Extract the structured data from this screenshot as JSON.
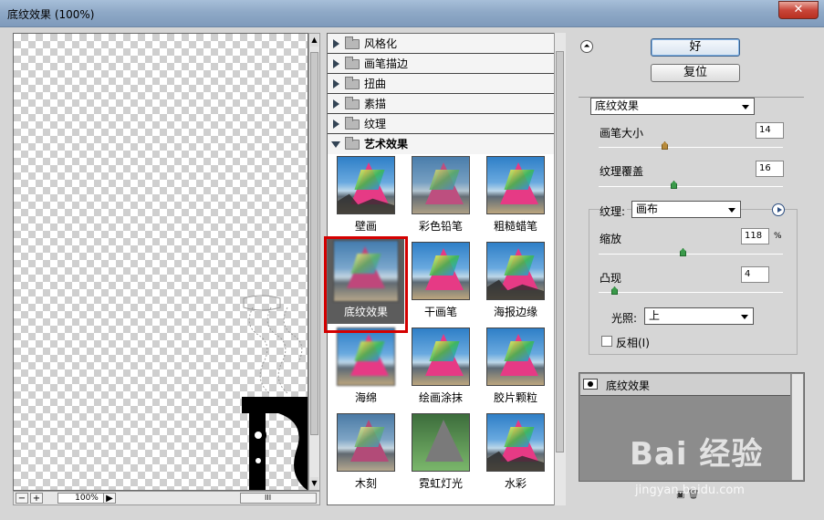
{
  "window": {
    "title": "底纹效果 (100%)",
    "close_label": "✕"
  },
  "preview": {
    "zoom": "100%",
    "minus": "−",
    "plus": "+",
    "scroll_grip": "III"
  },
  "gallery": {
    "categories": [
      {
        "label": "风格化",
        "expanded": false
      },
      {
        "label": "画笔描边",
        "expanded": false
      },
      {
        "label": "扭曲",
        "expanded": false
      },
      {
        "label": "素描",
        "expanded": false
      },
      {
        "label": "纹理",
        "expanded": false
      },
      {
        "label": "艺术效果",
        "expanded": true
      }
    ],
    "filters": [
      {
        "label": "壁画"
      },
      {
        "label": "彩色铅笔"
      },
      {
        "label": "粗糙蜡笔"
      },
      {
        "label": "底纹效果",
        "selected": true
      },
      {
        "label": "干画笔"
      },
      {
        "label": "海报边缘"
      },
      {
        "label": "海绵"
      },
      {
        "label": "绘画涂抹"
      },
      {
        "label": "胶片颗粒"
      },
      {
        "label": "木刻"
      },
      {
        "label": "霓虹灯光"
      },
      {
        "label": "水彩"
      }
    ]
  },
  "buttons": {
    "ok": "好",
    "reset": "复位",
    "collapse_icon": "⏶"
  },
  "settings": {
    "filter_select": "底纹效果",
    "brush_size_label": "画笔大小",
    "brush_size_value": "14",
    "texture_coverage_label": "纹理覆盖",
    "texture_coverage_value": "16",
    "texture_label": "纹理:",
    "texture_select": "画布",
    "scaling_label": "缩放",
    "scaling_value": "118",
    "scaling_unit": "%",
    "relief_label": "凸现",
    "relief_value": "4",
    "light_label": "光照:",
    "light_select": "上",
    "invert_label": "反相(I)"
  },
  "layers": {
    "items": [
      {
        "name": "底纹效果"
      }
    ]
  },
  "watermark": {
    "brand": "Bai 经验",
    "url": "jingyan.baidu.com"
  },
  "colors": {
    "accent_red": "#d40000",
    "selected_bg": "#5c5c5c"
  }
}
